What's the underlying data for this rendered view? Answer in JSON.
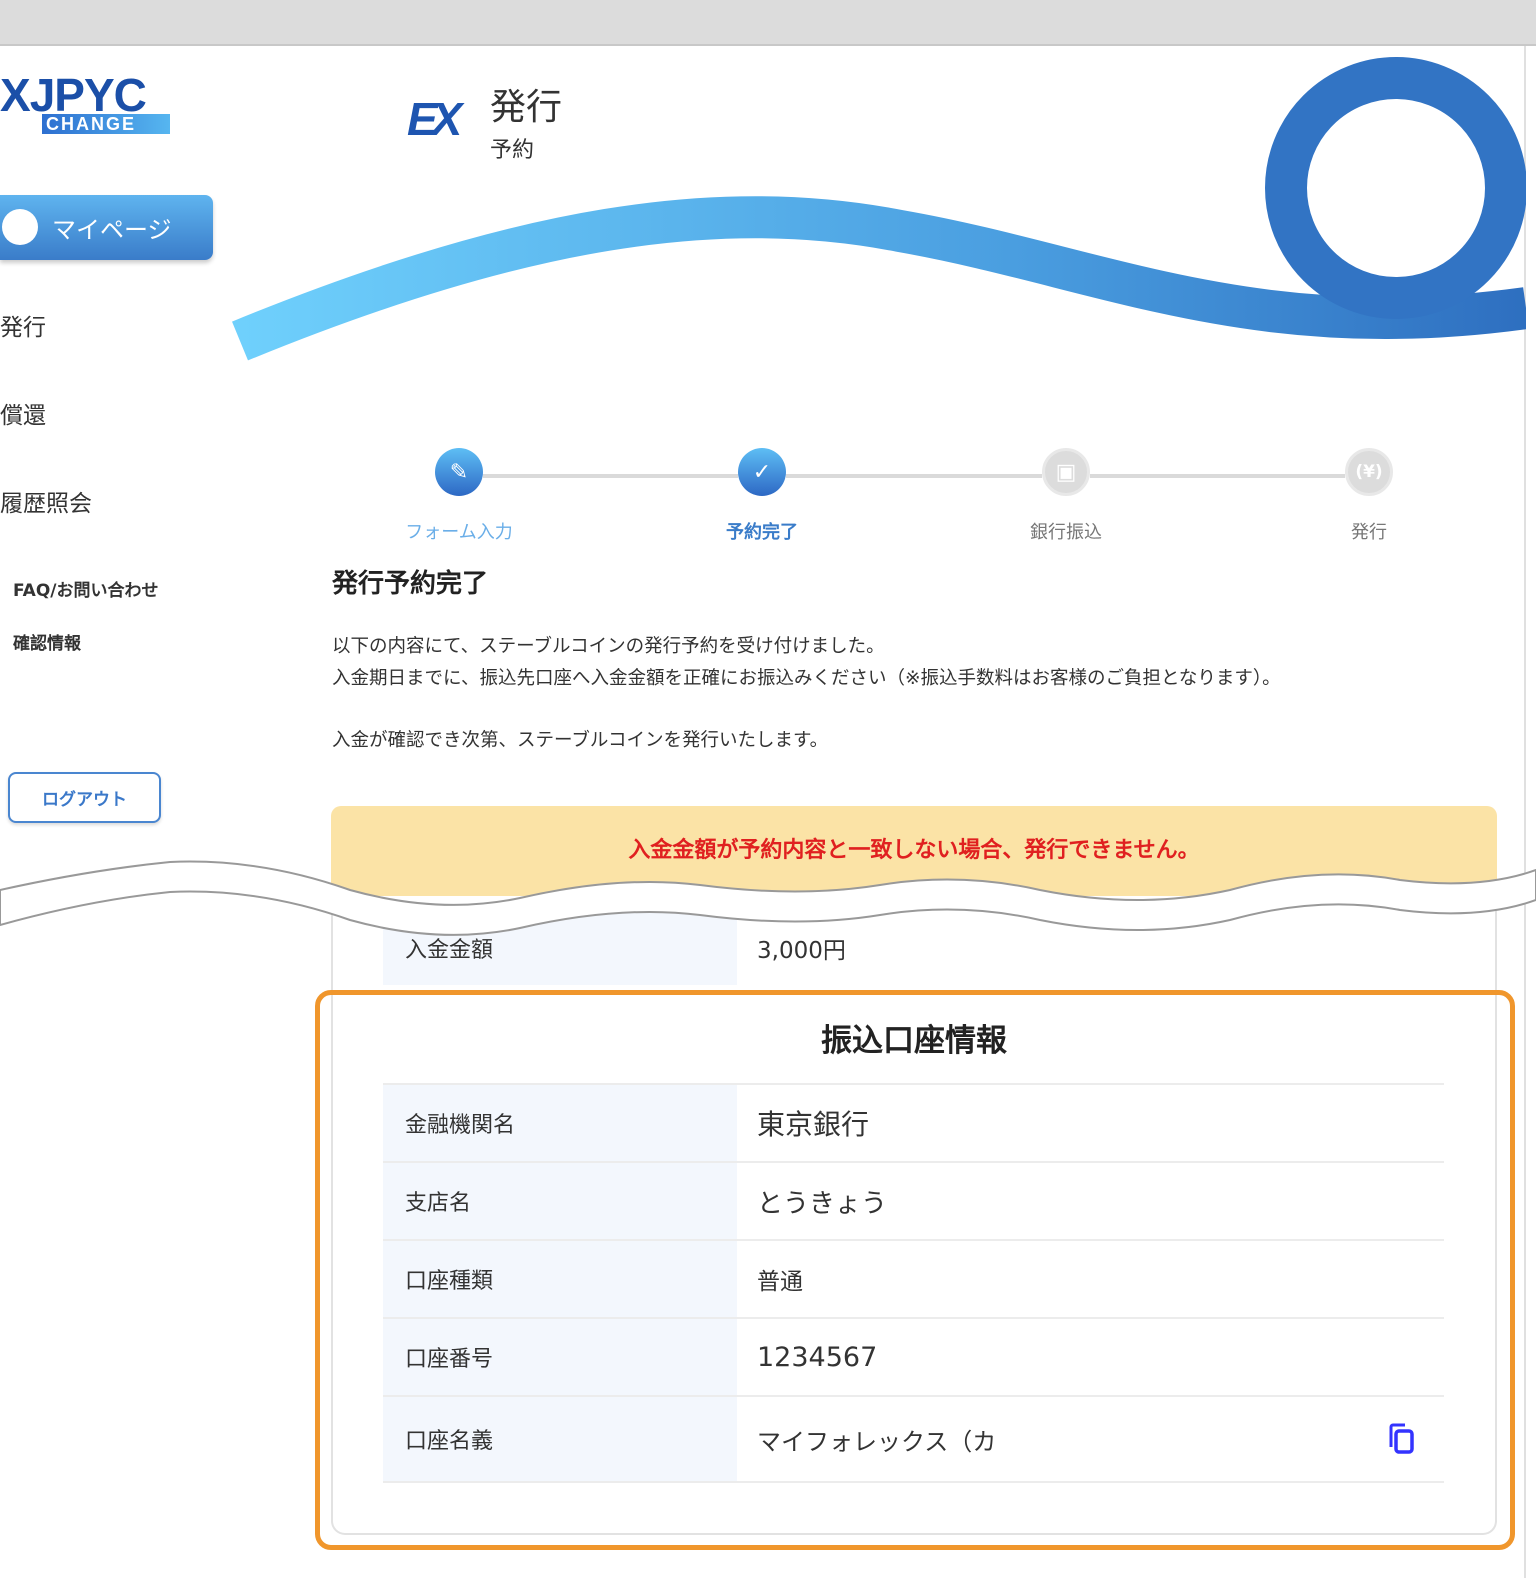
{
  "logo": {
    "main": "JPYC",
    "sub": "CHANGE"
  },
  "sidebar": {
    "mypage": "マイページ",
    "items": [
      {
        "label": "発行"
      },
      {
        "label": "償還"
      },
      {
        "label": "履歴照会"
      }
    ],
    "links": [
      {
        "label": "FAQ/お問い合わせ"
      },
      {
        "label": "確認情報"
      }
    ],
    "logout": "ログアウト"
  },
  "header": {
    "badge": "EX",
    "title": "発行",
    "subtitle": "予約"
  },
  "steps": [
    {
      "label": "フォーム入力",
      "state": "done",
      "icon": "pencil-icon"
    },
    {
      "label": "予約完了",
      "state": "current",
      "icon": "check-icon"
    },
    {
      "label": "銀行振込",
      "state": "pending",
      "icon": "bank-transfer-icon"
    },
    {
      "label": "発行",
      "state": "pending",
      "icon": "yen-icon"
    }
  ],
  "main": {
    "title": "発行予約完了",
    "lines": [
      "以下の内容にて、ステーブルコインの発行予約を受け付けました。",
      "入金期日までに、振込先口座へ入金金額を正確にお振込みください（※振込手数料はお客様のご負担となります）。",
      "入金が確認でき次第、ステーブルコインを発行いたします。"
    ],
    "warning": "入金金額が予約内容と一致しない場合、発行できません。",
    "amount": {
      "label": "入金金額",
      "value": "3,000円"
    }
  },
  "bank": {
    "title": "振込口座情報",
    "rows": [
      {
        "label": "金融機関名",
        "value": "東京銀行"
      },
      {
        "label": "支店名",
        "value": "とうきょう"
      },
      {
        "label": "口座種類",
        "value": "普通"
      },
      {
        "label": "口座番号",
        "value": "1234567"
      },
      {
        "label": "口座名義",
        "value": "マイフォレックス（カ"
      }
    ]
  },
  "colors": {
    "accent": "#3a7cc9",
    "warning_bg": "#fbe3a6",
    "warning_text": "#e02020",
    "highlight": "#f0962c",
    "copy_icon": "#3333ff"
  }
}
